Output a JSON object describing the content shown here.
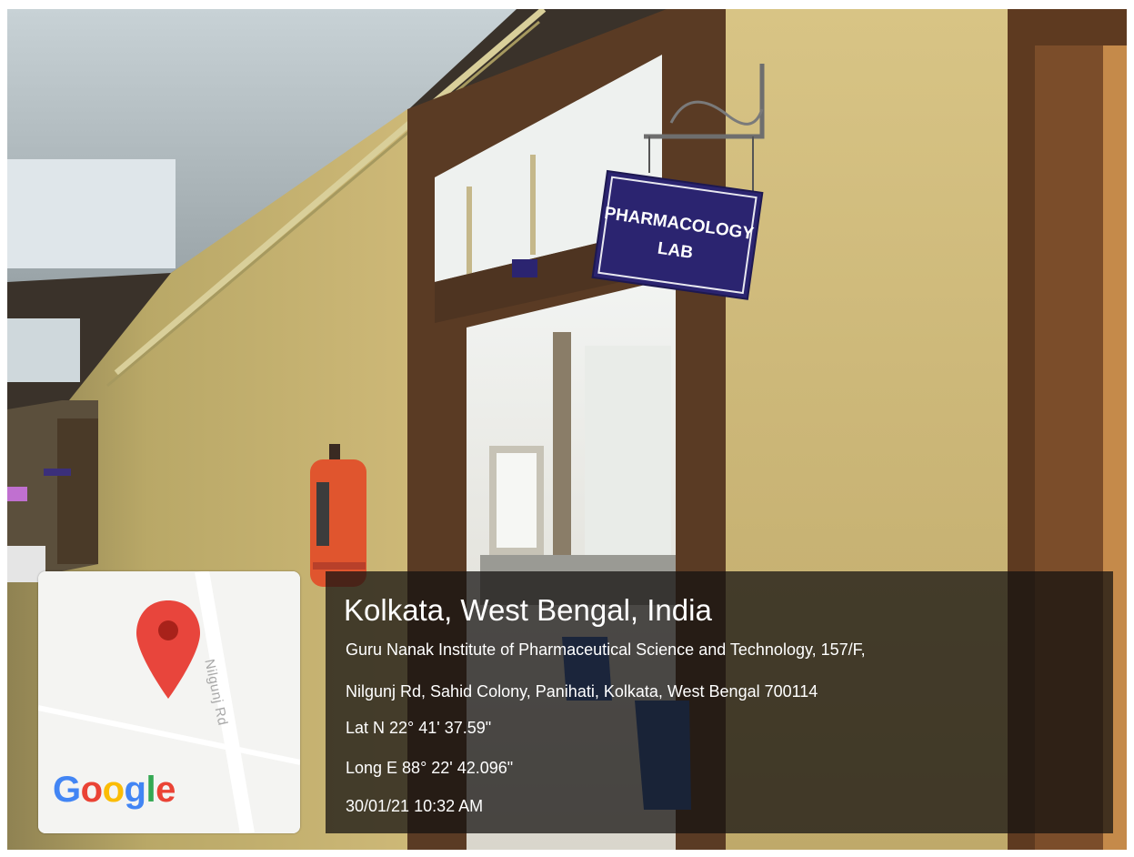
{
  "photo": {
    "sign": {
      "line1": "PHARMACOLOGY",
      "line2": "LAB"
    }
  },
  "map": {
    "road_label": "Nilgunj Rd",
    "pin_icon": "map-pin-icon",
    "logo": {
      "letters": [
        "G",
        "o",
        "o",
        "g",
        "l",
        "e"
      ],
      "colors": [
        "#4285F4",
        "#EA4335",
        "#FBBC05",
        "#4285F4",
        "#34A853",
        "#EA4335"
      ]
    }
  },
  "location": {
    "title": "Kolkata, West Bengal, India",
    "address_line1": "Guru Nanak Institute of Pharmaceutical Science and Technology, 157/F,",
    "address_line2": "Nilgunj Rd, Sahid Colony, Panihati, Kolkata, West Bengal 700114",
    "latitude": "Lat N 22° 41' 37.59\"",
    "longitude": "Long E 88° 22' 42.096\"",
    "timestamp": "30/01/21 10:32 AM"
  },
  "colors": {
    "wall": "#c9b46f",
    "door_frame": "#5a3b24",
    "sign_bg": "#2b2470",
    "extinguisher": "#e0552e",
    "pin": "#e8453c"
  }
}
